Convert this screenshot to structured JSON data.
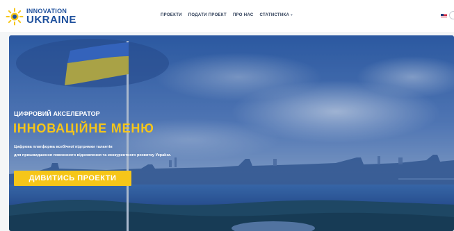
{
  "header": {
    "logo_top": "INNOVATION",
    "logo_bottom": "UKRAINE",
    "nav": [
      {
        "label": "ПРОЕКТИ"
      },
      {
        "label": "ПОДАТИ ПРОЕКТ"
      },
      {
        "label": "ПРО НАС"
      },
      {
        "label": "СТАТИСТИКА"
      }
    ],
    "language_icon": "us-flag-icon"
  },
  "hero": {
    "eyebrow": "ЦИФРОВИЙ АКСЕЛЕРАТОР",
    "title": "ІННОВАЦІЙНЕ МЕНЮ",
    "description_line1": "Цифрова платформа всебічної підтримки талантів",
    "description_line2": "для пришвидшення повоєнного відновлення та конкурентного розвитку України.",
    "cta_label": "ДИВИТИСЬ ПРОЕКТИ"
  },
  "colors": {
    "brand_blue": "#1d4f9c",
    "brand_yellow": "#f6c619",
    "overlay": "#1d3f80"
  }
}
